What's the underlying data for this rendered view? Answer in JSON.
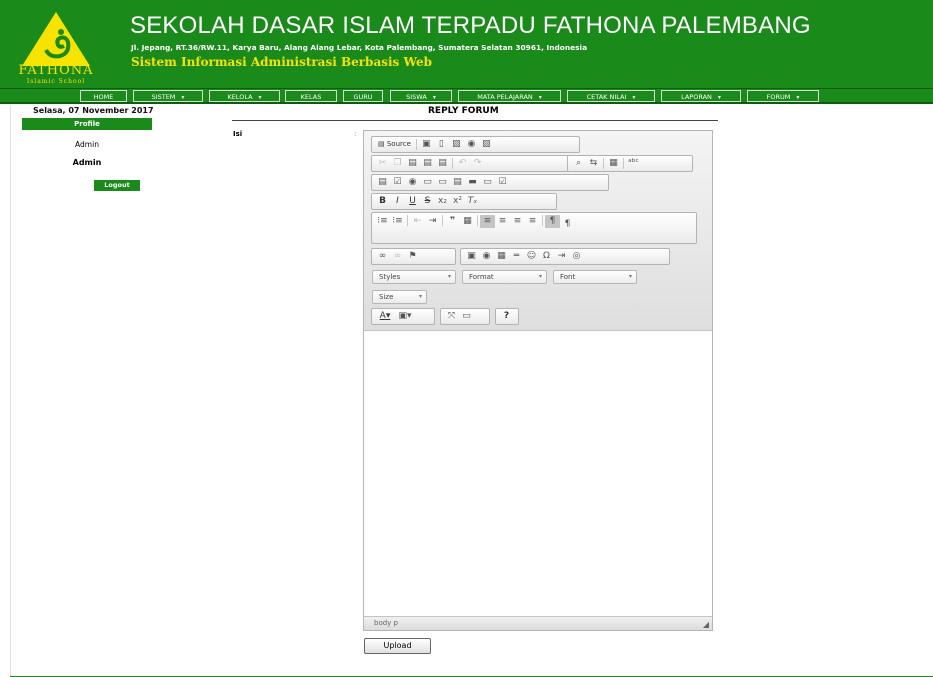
{
  "header": {
    "logo_text": "FATHONA",
    "logo_sub": "Islamic School",
    "school_name": "SEKOLAH DASAR ISLAM TERPADU FATHONA PALEMBANG",
    "address": "Jl. Jepang, RT.36/RW.11, Karya Baru, Alang Alang Lebar, Kota Palembang, Sumatera Selatan 30961, Indonesia",
    "system_name": "Sistem Informasi Administrasi Berbasis Web",
    "brand_color": "#1a8a1a",
    "accent_color": "#f7e300"
  },
  "nav": {
    "items": [
      {
        "label": "HOME",
        "dropdown": false
      },
      {
        "label": "SISTEM",
        "dropdown": true
      },
      {
        "label": "KELOLA",
        "dropdown": true
      },
      {
        "label": "KELAS",
        "dropdown": false
      },
      {
        "label": "GURU",
        "dropdown": false
      },
      {
        "label": "SISWA",
        "dropdown": true
      },
      {
        "label": "MATA PELAJARAN",
        "dropdown": true
      },
      {
        "label": "CETAK NILAI",
        "dropdown": true
      },
      {
        "label": "LAPORAN",
        "dropdown": true
      },
      {
        "label": "FORUM",
        "dropdown": true
      }
    ],
    "arrow": "▾"
  },
  "sidebar": {
    "date": "Selasa, 07 November 2017",
    "profile_label": "Profile",
    "user_name": "Admin",
    "user_role": "Admin",
    "logout_label": "Logout"
  },
  "main": {
    "title": "REPLY FORUM",
    "field_label": "Isi",
    "field_colon": ":",
    "editor": {
      "source_label": "Source",
      "styles_label": "Styles",
      "format_label": "Format",
      "font_label": "Font",
      "size_label": "Size",
      "path_text": "body  p",
      "combo_arrow": "▾",
      "resize_glyph": "◢"
    },
    "upload_label": "Upload"
  }
}
